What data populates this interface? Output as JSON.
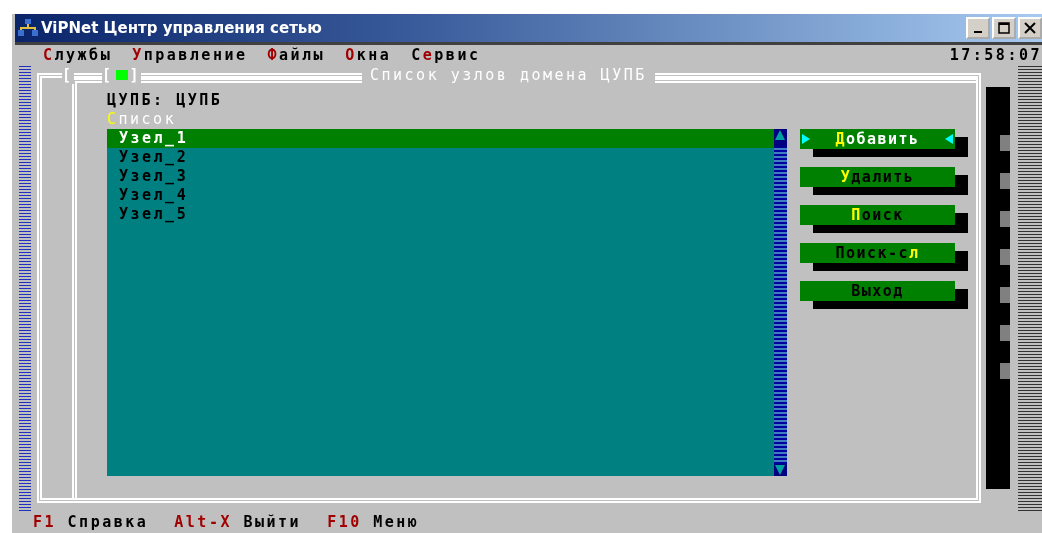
{
  "window": {
    "title": "ViPNet Центр управления сетью"
  },
  "menu": [
    {
      "key": "С",
      "post": "лужбы"
    },
    {
      "key": "У",
      "post": "правление"
    },
    {
      "key": "Ф",
      "post": "айлы"
    },
    {
      "key": "О",
      "post": "кна"
    },
    {
      "pre": "С",
      "key": "е",
      "post": "рвис"
    }
  ],
  "clock": "17:58:07",
  "frame": {
    "outer_bracket": "[",
    "close_box": {
      "open": "[",
      "close": "]"
    },
    "title": "Список узлов домена ЦУПБ"
  },
  "domain_label": "ЦУПБ: ЦУПБ",
  "list_label": {
    "key": "С",
    "post": "писок"
  },
  "nodes": [
    {
      "name": "Узел_1",
      "selected": true
    },
    {
      "name": "Узел_2",
      "selected": false
    },
    {
      "name": "Узел_3",
      "selected": false
    },
    {
      "name": "Узел_4",
      "selected": false
    },
    {
      "name": "Узел_5",
      "selected": false
    }
  ],
  "buttons": [
    {
      "key": "Д",
      "post": "обавить",
      "selected": true
    },
    {
      "key": "У",
      "post": "далить",
      "selected": false
    },
    {
      "key": "П",
      "post": "оиск",
      "selected": false
    },
    {
      "pre": "Поиск-с",
      "key": "л",
      "selected": false
    },
    {
      "pre": "Выход",
      "selected": false
    }
  ],
  "status_bar": [
    {
      "key": "F1",
      "label": "Справка"
    },
    {
      "key": "Alt-X",
      "label": "Выйти"
    },
    {
      "key": "F10",
      "label": "Меню"
    }
  ]
}
